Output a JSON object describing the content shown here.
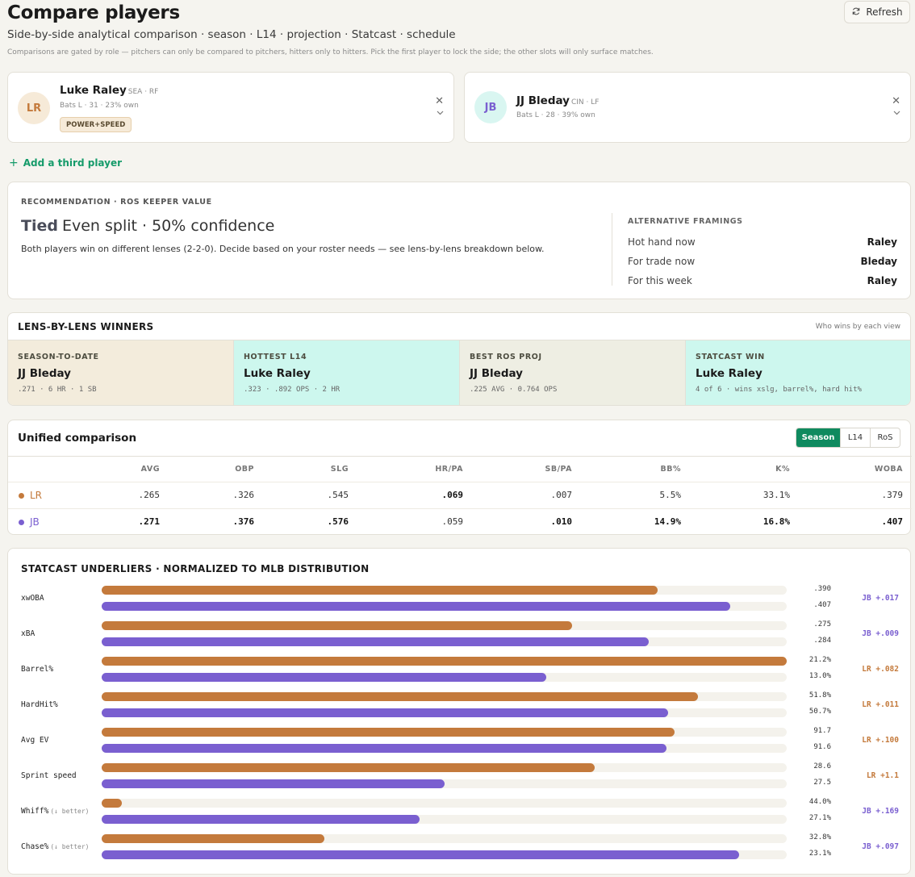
{
  "header": {
    "title": "Compare players",
    "subtitle": "Side-by-side analytical comparison · season · L14 · projection · Statcast · schedule",
    "note": "Comparisons are gated by role — pitchers can only be compared to pitchers, hitters only to hitters. Pick the first player to lock the side; the other slots will only surface matches.",
    "refresh_label": "Refresh"
  },
  "colors": {
    "lr": "#c47a3c",
    "jb": "#7a5fd0",
    "accent": "#0f8a5f"
  },
  "players": [
    {
      "initials": "LR",
      "name": "Luke Raley",
      "team_pos": "SEA · RF",
      "meta": "Bats L · 31 · 23% own",
      "tag": "POWER+SPEED"
    },
    {
      "initials": "JB",
      "name": "JJ Bleday",
      "team_pos": "CIN · LF",
      "meta": "Bats L · 28 · 39% own"
    }
  ],
  "add_third": "Add a third player",
  "recommendation": {
    "label": "RECOMMENDATION · ROS KEEPER VALUE",
    "verdict": "Tied",
    "headline": "Even split · 50% confidence",
    "body": "Both players win on different lenses (2-2-0). Decide based on your roster needs — see lens-by-lens breakdown below.",
    "alt_label": "ALTERNATIVE FRAMINGS",
    "alternatives": [
      {
        "label": "Hot hand now",
        "value": "Raley"
      },
      {
        "label": "For trade now",
        "value": "Bleday"
      },
      {
        "label": "For this week",
        "value": "Raley"
      }
    ]
  },
  "lenses": {
    "title": "LENS-BY-LENS WINNERS",
    "hint": "Who wins by each view",
    "cells": [
      {
        "title": "SEASON-TO-DATE",
        "winner": "JJ Bleday",
        "detail": ".271 · 6 HR · 1 SB",
        "bg": "#f3ecdc"
      },
      {
        "title": "HOTTEST L14",
        "winner": "Luke Raley",
        "detail": ".323 · .892 OPS · 2 HR",
        "bg": "#cdf7ee"
      },
      {
        "title": "BEST ROS PROJ",
        "winner": "JJ Bleday",
        "detail": ".225 AVG · 0.764 OPS",
        "bg": "#eeeee3"
      },
      {
        "title": "STATCAST WIN",
        "winner": "Luke Raley",
        "detail": "4 of 6 · wins xslg, barrel%, hard hit%",
        "bg": "#cdf7ee"
      }
    ]
  },
  "unified": {
    "title": "Unified comparison",
    "tabs": [
      "Season",
      "L14",
      "RoS"
    ],
    "active_tab": "Season",
    "columns": [
      "AVG",
      "OBP",
      "SLG",
      "HR/PA",
      "SB/PA",
      "BB%",
      "K%",
      "WOBA"
    ],
    "rows": [
      {
        "label": "LR",
        "values": [
          ".265",
          ".326",
          ".545",
          ".069",
          ".007",
          "5.5%",
          "33.1%",
          ".379"
        ],
        "bold": [
          false,
          false,
          false,
          true,
          false,
          false,
          false,
          false
        ]
      },
      {
        "label": "JB",
        "values": [
          ".271",
          ".376",
          ".576",
          ".059",
          ".010",
          "14.9%",
          "16.8%",
          ".407"
        ],
        "bold": [
          true,
          true,
          true,
          false,
          true,
          true,
          true,
          true
        ]
      }
    ]
  },
  "statcast": {
    "title": "STATCAST UNDERLIERS · NORMALIZED TO MLB DISTRIBUTION",
    "metrics": [
      {
        "name": "xwOBA",
        "sub": "",
        "lr": ".390",
        "jb": ".407",
        "lr_pct": 0.812,
        "jb_pct": 0.918,
        "delta": "JB +.017",
        "winner": "jb"
      },
      {
        "name": "xBA",
        "sub": "",
        "lr": ".275",
        "jb": ".284",
        "lr_pct": 0.687,
        "jb_pct": 0.798,
        "delta": "JB +.009",
        "winner": "jb"
      },
      {
        "name": "Barrel%",
        "sub": "",
        "lr": "21.2%",
        "jb": "13.0%",
        "lr_pct": 1.0,
        "jb_pct": 0.649,
        "delta": "LR +.082",
        "winner": "lr"
      },
      {
        "name": "HardHit%",
        "sub": "",
        "lr": "51.8%",
        "jb": "50.7%",
        "lr_pct": 0.87,
        "jb_pct": 0.827,
        "delta": "LR +.011",
        "winner": "lr"
      },
      {
        "name": "Avg EV",
        "sub": "",
        "lr": "91.7",
        "jb": "91.6",
        "lr_pct": 0.836,
        "jb_pct": 0.824,
        "delta": "LR +.100",
        "winner": "lr"
      },
      {
        "name": "Sprint speed",
        "sub": "",
        "lr": "28.6",
        "jb": "27.5",
        "lr_pct": 0.72,
        "jb_pct": 0.5,
        "delta": "LR +1.1",
        "winner": "lr"
      },
      {
        "name": "Whiff%",
        "sub": "(↓ better)",
        "lr": "44.0%",
        "jb": "27.1%",
        "lr_pct": 0.03,
        "jb_pct": 0.464,
        "delta": "JB +.169",
        "winner": "jb"
      },
      {
        "name": "Chase%",
        "sub": "(↓ better)",
        "lr": "32.8%",
        "jb": "23.1%",
        "lr_pct": 0.325,
        "jb_pct": 0.93,
        "delta": "JB +.097",
        "winner": "jb"
      }
    ]
  }
}
